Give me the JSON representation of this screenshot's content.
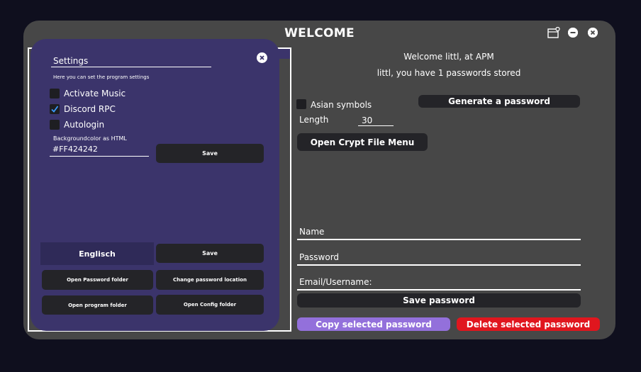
{
  "window": {
    "title": "WELCOME",
    "icons": {
      "extra": "window-settings-icon",
      "minimize": "minimize-icon",
      "close": "close-icon"
    }
  },
  "main": {
    "welcome_line1": "Welcome littl, at APM",
    "welcome_line2": "littl, you have 1 passwords stored",
    "asian_symbols_label": "Asian symbols",
    "asian_symbols_checked": false,
    "generate_button": "Generate a password",
    "length_label": "Length",
    "length_value": "30",
    "open_crypt_button": "Open Crypt File Menu",
    "name_placeholder": "Name",
    "password_placeholder": "Password",
    "email_placeholder": "Email/Username:",
    "save_password_button": "Save password",
    "copy_button": "Copy selected password",
    "delete_button": "Delete selected password"
  },
  "settings": {
    "title": "Settings",
    "description": "Here you can set the program settings",
    "options": [
      {
        "label": "Activate Music",
        "checked": false
      },
      {
        "label": "Discord RPC",
        "checked": true
      },
      {
        "label": "Autologin",
        "checked": false
      }
    ],
    "bg_label": "Backgroundcolor as HTML",
    "bg_value": "#FF424242",
    "save_bg_button": "Save",
    "language": "Englisch",
    "save_lang_button": "Save",
    "open_password_folder": "Open Password folder",
    "change_password_location": "Change password location",
    "open_program_folder": "Open program folder",
    "open_config_folder": "Open Config folder"
  },
  "colors": {
    "window_bg": "#474747",
    "panel_bg": "#3b346b",
    "button_bg": "#242428",
    "copy_bg": "#9370db",
    "delete_bg": "#e0161e"
  }
}
